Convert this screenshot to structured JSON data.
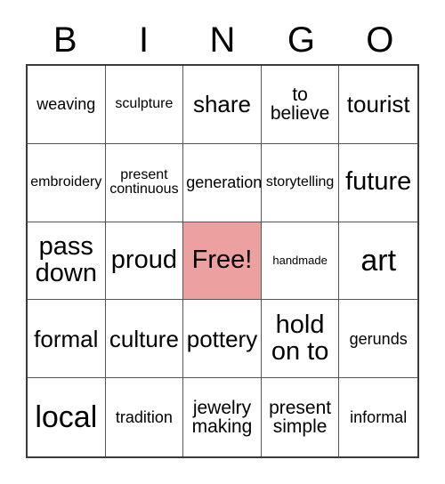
{
  "card": {
    "title": "BINGO",
    "header_letters": [
      "B",
      "I",
      "N",
      "G",
      "O"
    ],
    "free_space_color": "#eda0a0",
    "border_color": "#3a3a3a",
    "grid_line_color": "#555555",
    "rows": [
      [
        {
          "text": "weaving",
          "size": "sz-m",
          "free": false
        },
        {
          "text": "sculpture",
          "size": "sz-s",
          "free": false
        },
        {
          "text": "share",
          "size": "sz-xl",
          "free": false
        },
        {
          "text": "to\nbelieve",
          "size": "sz-l",
          "free": false
        },
        {
          "text": "tourist",
          "size": "sz-xl",
          "free": false
        }
      ],
      [
        {
          "text": "embroidery",
          "size": "sz-s",
          "free": false
        },
        {
          "text": "present\ncontinuous",
          "size": "sz-s",
          "free": false
        },
        {
          "text": "generation",
          "size": "sz-m",
          "free": false
        },
        {
          "text": "storytelling",
          "size": "sz-s",
          "free": false
        },
        {
          "text": "future",
          "size": "sz-xxl",
          "free": false
        }
      ],
      [
        {
          "text": "pass\ndown",
          "size": "sz-xxl",
          "free": false
        },
        {
          "text": "proud",
          "size": "sz-xxl",
          "free": false
        },
        {
          "text": "Free!",
          "size": "sz-xxl",
          "free": true
        },
        {
          "text": "handmade",
          "size": "sz-xs",
          "free": false
        },
        {
          "text": "art",
          "size": "sz-huge",
          "free": false
        }
      ],
      [
        {
          "text": "formal",
          "size": "sz-xl",
          "free": false
        },
        {
          "text": "culture",
          "size": "sz-xl",
          "free": false
        },
        {
          "text": "pottery",
          "size": "sz-xl",
          "free": false
        },
        {
          "text": "hold\non to",
          "size": "sz-xxl",
          "free": false
        },
        {
          "text": "gerunds",
          "size": "sz-m",
          "free": false
        }
      ],
      [
        {
          "text": "local",
          "size": "sz-huge",
          "free": false
        },
        {
          "text": "tradition",
          "size": "sz-m",
          "free": false
        },
        {
          "text": "jewelry\nmaking",
          "size": "sz-l",
          "free": false
        },
        {
          "text": "present\nsimple",
          "size": "sz-l",
          "free": false
        },
        {
          "text": "informal",
          "size": "sz-m",
          "free": false
        }
      ]
    ]
  }
}
